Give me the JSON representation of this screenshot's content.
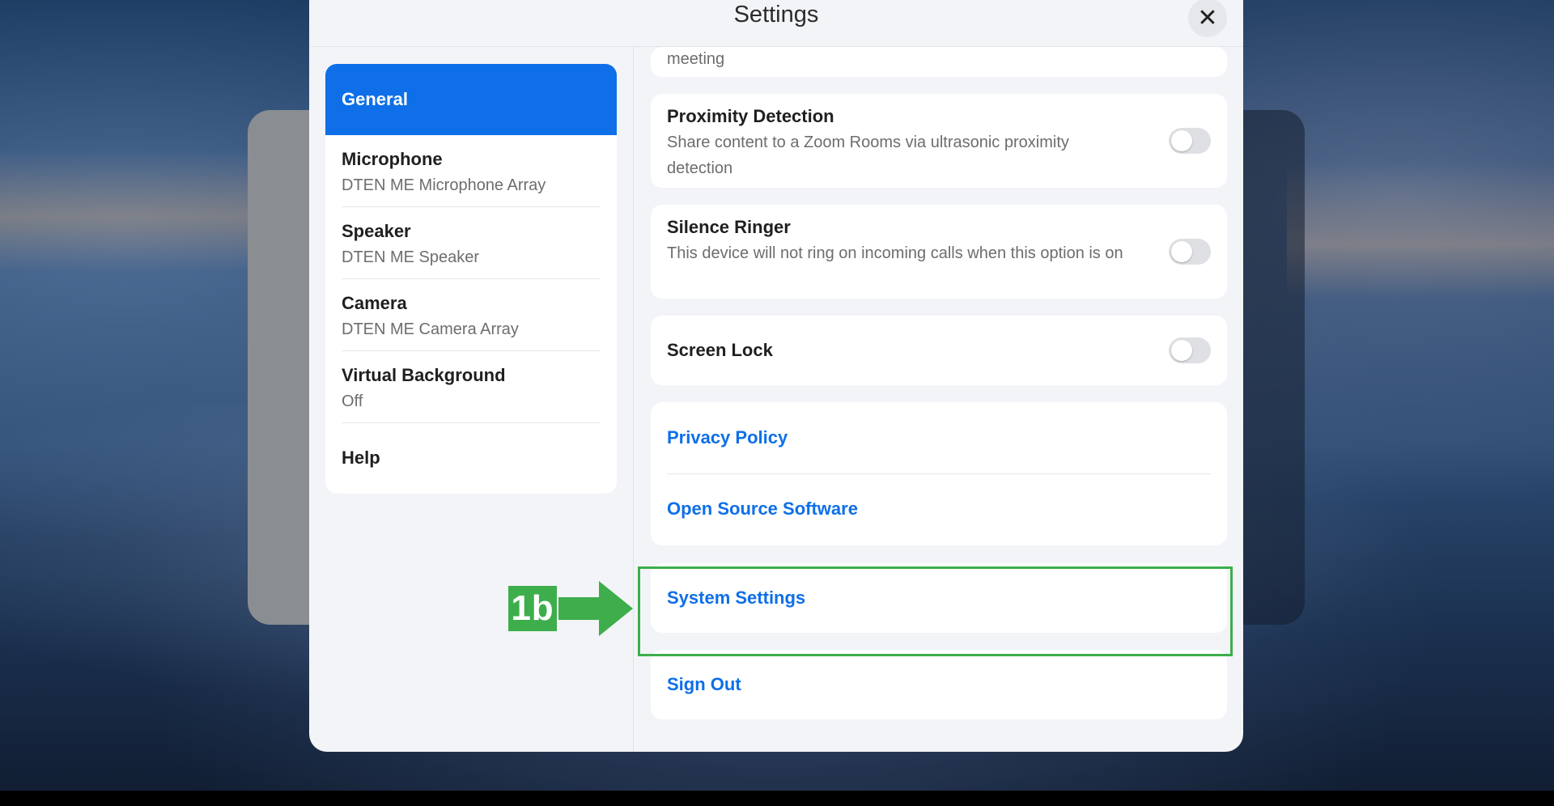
{
  "dialog": {
    "title": "Settings",
    "close_icon": "close-icon"
  },
  "nav": {
    "active": "General",
    "items": [
      {
        "title": "Microphone",
        "sub": "DTEN ME Microphone Array"
      },
      {
        "title": "Speaker",
        "sub": "DTEN ME Speaker"
      },
      {
        "title": "Camera",
        "sub": "DTEN ME Camera Array"
      },
      {
        "title": "Virtual Background",
        "sub": "Off"
      }
    ],
    "help": "Help"
  },
  "content": {
    "partial_text": "meeting",
    "proximity": {
      "title": "Proximity Detection",
      "desc": "Share content to a Zoom Rooms via ultrasonic proximity detection",
      "enabled": false
    },
    "silence": {
      "title": "Silence Ringer",
      "desc": "This device will not ring on incoming calls when this option is on",
      "enabled": false
    },
    "screen_lock": {
      "title": "Screen Lock",
      "enabled": false
    },
    "links": {
      "privacy": "Privacy Policy",
      "open_source": "Open Source Software",
      "system_settings": "System Settings",
      "sign_out": "Sign Out"
    }
  },
  "annotation": {
    "label": "1b",
    "color": "#3dae4b"
  },
  "colors": {
    "accent": "#0e6fe8",
    "highlight": "#3dae4b"
  }
}
